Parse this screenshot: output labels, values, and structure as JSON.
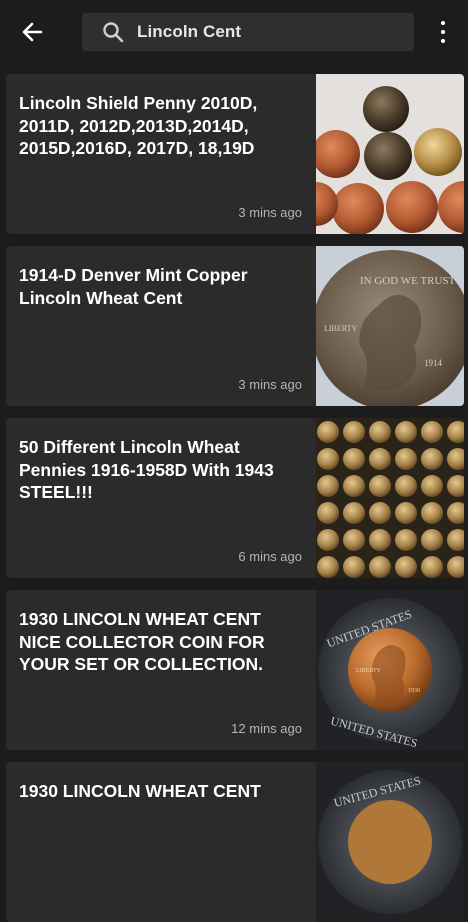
{
  "header": {
    "search_value": "Lincoln Cent",
    "back_icon": "arrow-left-icon",
    "search_icon": "magnifier-icon",
    "menu_icon": "more-vertical-icon"
  },
  "listings": [
    {
      "title": "Lincoln Shield Penny 2010D, 2011D, 2012D,2013D,2014D, 2015D,2016D, 2017D, 18,19D",
      "time": "3 mins ago"
    },
    {
      "title": "1914-D Denver Mint Copper Lincoln Wheat Cent",
      "time": "3 mins ago"
    },
    {
      "title": "50 Different Lincoln Wheat Pennies 1916-1958D With 1943 STEEL!!!",
      "time": "6 mins ago"
    },
    {
      "title": "1930 LINCOLN WHEAT CENT NICE COLLECTOR COIN FOR YOUR SET OR COLLECTION.",
      "time": "12 mins ago"
    },
    {
      "title": "1930 LINCOLN WHEAT CENT",
      "time": ""
    }
  ],
  "coin_lettering": {
    "coin2_top": "IN GOD WE TRUST",
    "coin2_side": "LIBERTY",
    "coin2_year": "1914",
    "coin4_top": "UNITED STATES",
    "coin4_bottom": "UNITED STATES",
    "coin4_side": "LIBERTY",
    "coin4_year": "1930",
    "coin5_top": "UNITED STATES"
  }
}
